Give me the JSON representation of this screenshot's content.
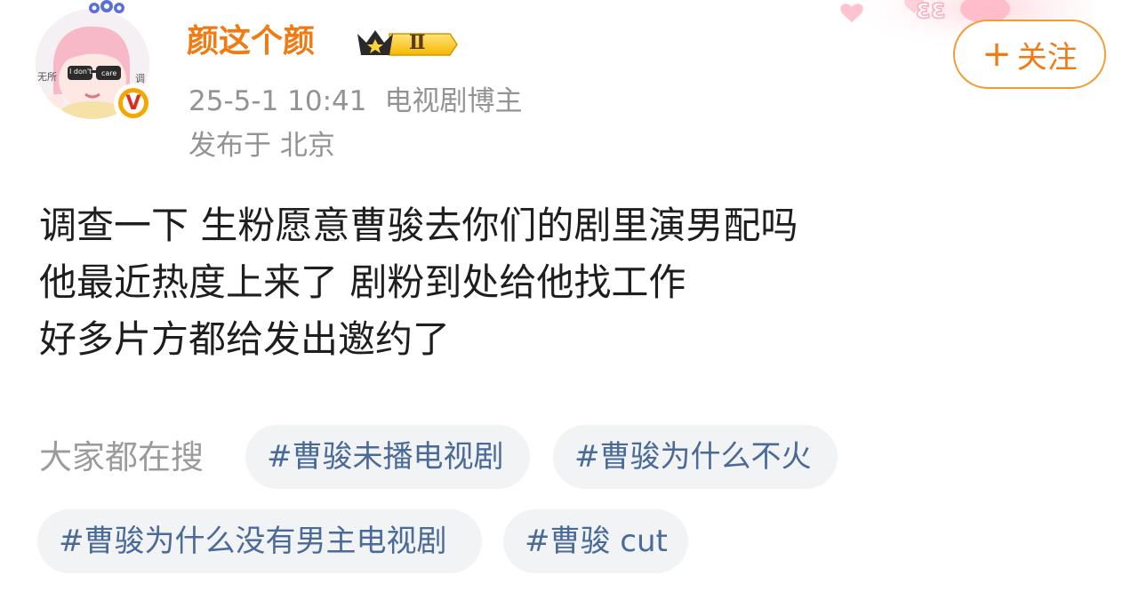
{
  "post": {
    "author": {
      "name": "颜这个颜",
      "vip_level": "Ⅱ",
      "avatar_text_left": "无所",
      "avatar_text_right": "调",
      "avatar_glasses_left": "I don't",
      "avatar_glasses_right": "care",
      "verify_mark": "V"
    },
    "date": "25-5-1 10:41",
    "role": "电视剧博主",
    "location": "发布于 北京",
    "follow_button": {
      "icon": "plus-icon",
      "label": "关注"
    },
    "body_lines": [
      "调查一下 生粉愿意曹骏去你们的剧里演男配吗",
      "他最近热度上来了 剧粉到处给他找工作",
      "好多片方都给发出邀约了"
    ]
  },
  "search": {
    "label": "大家都在搜",
    "tags": [
      "#曹骏未播电视剧",
      "#曹骏为什么不火",
      "#曹骏为什么没有男主电视剧",
      "#曹骏 cut"
    ]
  },
  "colors": {
    "accent_orange": "#f07b12",
    "tag_text": "#4a6a97",
    "tag_bg": "#f2f3f5",
    "meta_gray": "#939393"
  }
}
